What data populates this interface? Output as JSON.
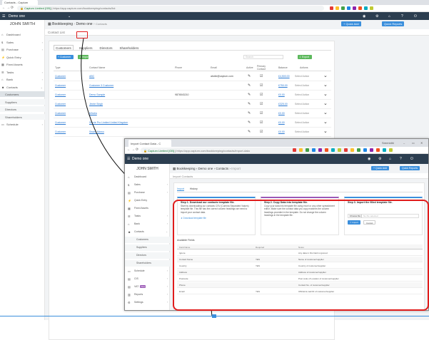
{
  "back": {
    "tab_title": "Contacts - Capium",
    "url_secure": "Capium Limited [GB]",
    "url_text": "https://app.capium.com/bookkeeping/contacts/list",
    "brand": "Demo one",
    "user": "JOHN SMITH",
    "sidebar": [
      {
        "label": "Dashboard",
        "icon": "⌂",
        "chev": ""
      },
      {
        "label": "Sales",
        "icon": "$",
        "chev": "›"
      },
      {
        "label": "Purchase",
        "icon": "▤",
        "chev": "›"
      },
      {
        "label": "Quick Entry",
        "icon": "⚡",
        "chev": ""
      },
      {
        "label": "Fixed Assets",
        "icon": "▦",
        "chev": ""
      },
      {
        "label": "Tasks",
        "icon": "☰",
        "chev": "›"
      },
      {
        "label": "Bank",
        "icon": "⌂",
        "chev": "›"
      },
      {
        "label": "Contacts",
        "icon": "☻",
        "chev": "⌄"
      },
      {
        "label": "Customers",
        "icon": "",
        "chev": "",
        "sub": true,
        "active": true
      },
      {
        "label": "Suppliers",
        "icon": "",
        "chev": "",
        "sub": true
      },
      {
        "label": "Directors",
        "icon": "",
        "chev": "",
        "sub": true
      },
      {
        "label": "Shareholders",
        "icon": "",
        "chev": "",
        "sub": true
      },
      {
        "label": "Schedule",
        "icon": "▭",
        "chev": "›"
      }
    ],
    "breadcrumb": [
      "Bookkeeping",
      "Demo one",
      "Contacts"
    ],
    "quick_add": "+ Quick Add",
    "quick_reports": "Quick Reports",
    "page_heading": "Contact List",
    "tabs": [
      "Customers",
      "Suppliers",
      "Directors",
      "Shareholders"
    ],
    "add_label": "+ Customer",
    "import_label": "⇩ Import",
    "export_label": "⇩ Export",
    "search_placeholder": "Search",
    "columns": [
      "Type",
      "Contact Name",
      "Phone",
      "Email",
      "Active",
      "Primary Contact",
      "Balance",
      "Actions"
    ],
    "rows": [
      {
        "type": "Customer",
        "name": "ABC",
        "phone": "",
        "email": "abcltd@capium.com",
        "balance": "£4,500.00",
        "action": "Select Action"
      },
      {
        "type": "Customer",
        "name": "Customer 3 Customer",
        "phone": "",
        "email": "",
        "balance": "£750.00",
        "action": "Select Action"
      },
      {
        "type": "Customer",
        "name": "Demo Sample",
        "phone": "9876543210",
        "email": "",
        "balance": "£0.00",
        "action": "Select Action"
      },
      {
        "type": "Customer",
        "name": "Jinnie Singh",
        "phone": "",
        "email": "",
        "balance": "£325.00",
        "action": "Select Action"
      },
      {
        "type": "Customer",
        "name": "Mindra",
        "phone": "",
        "email": "",
        "balance": "£0.00",
        "action": "Select Action"
      },
      {
        "type": "Customer",
        "name": "Stevie Pro Limited United Kingdom",
        "phone": "",
        "email": "",
        "balance": "£0.00",
        "action": "Select Action"
      },
      {
        "type": "Customer",
        "name": "Swara Maroo",
        "phone": "",
        "email": "",
        "balance": "£0.00",
        "action": "Select Action"
      }
    ]
  },
  "front": {
    "tab_title": "Import Contact Data - C",
    "win_user": "Sreenidhi",
    "url_secure": "Capium Limited [GB]",
    "url_text": "https://app.capium.com/bookkeeping/contacts/import-data",
    "brand": "Demo one",
    "user": "JOHN SMITH",
    "sidebar": [
      {
        "label": "Dashboard",
        "icon": "⌂",
        "chev": ""
      },
      {
        "label": "Sales",
        "icon": "$",
        "chev": "›"
      },
      {
        "label": "Purchase",
        "icon": "▤",
        "chev": "›"
      },
      {
        "label": "Quick Entry",
        "icon": "⚡",
        "chev": ""
      },
      {
        "label": "Fixed Assets",
        "icon": "▦",
        "chev": ""
      },
      {
        "label": "Tasks",
        "icon": "☰",
        "chev": "›"
      },
      {
        "label": "Bank",
        "icon": "⌂",
        "chev": "›"
      },
      {
        "label": "Contacts",
        "icon": "☻",
        "chev": "⌄"
      },
      {
        "label": "Customers",
        "icon": "",
        "chev": "",
        "sub": true
      },
      {
        "label": "Suppliers",
        "icon": "",
        "chev": "",
        "sub": true
      },
      {
        "label": "Directors",
        "icon": "",
        "chev": "",
        "sub": true
      },
      {
        "label": "Shareholders",
        "icon": "",
        "chev": "",
        "sub": true
      },
      {
        "label": "Schedule",
        "icon": "▭",
        "chev": "›"
      },
      {
        "label": "CIS",
        "icon": "▤",
        "chev": "›"
      },
      {
        "label": "VAT",
        "icon": "▤",
        "chev": "›",
        "badge": "New"
      },
      {
        "label": "Reports",
        "icon": "▥",
        "chev": "›"
      },
      {
        "label": "Settings",
        "icon": "⚙",
        "chev": "›"
      }
    ],
    "breadcrumb": [
      "Bookkeeping",
      "Demo one",
      "Contacts",
      "Import"
    ],
    "quick_add": "+ Quick Add",
    "quick_reports": "Quick Reports",
    "page_heading": "Import Contacts",
    "tabs": [
      "Import",
      "History"
    ],
    "steps": [
      {
        "title": "Step 1. Download our contacts template file.",
        "text": "Start by downloading our contacts CSV (Comma Separated Values) template file. This file has the correct column headings we need to import your contact data.",
        "link": "⬇ Download template file"
      },
      {
        "title": "Step 2. Copy Data into template file.",
        "text": "Copy your data into template file using excel or any other spreadsheet editor. Make sure the contact data you copy matches the column headings provided in the template. Do not change the column headings in the template file."
      },
      {
        "title": "Step 3. Import the filled template file.",
        "choose": "Choose file",
        "no_file": "No file selected",
        "import_btn": "⇩ Import",
        "cancel_btn": "Cancel"
      }
    ],
    "fields_heading": "Available Fields",
    "field_columns": [
      "Field Name",
      "Required",
      "Notes"
    ],
    "fields": [
      {
        "name": "Ignore",
        "req": "",
        "notes": "Any data in this field is ignored"
      },
      {
        "name": "Contact Name",
        "req": "YES",
        "notes": "Name of customer/supplier"
      },
      {
        "name": "Country",
        "req": "YES",
        "notes": "Country of customer/supplier"
      },
      {
        "name": "Address",
        "req": "",
        "notes": "Address of customer/supplier"
      },
      {
        "name": "Postcode",
        "req": "",
        "notes": "Post code of Location of customer/supplier"
      },
      {
        "name": "Phone",
        "req": "",
        "notes": "Contact No. of customer/supplier"
      },
      {
        "name": "Email",
        "req": "YES",
        "notes": "Official E-mail ID of customer/supplier"
      }
    ]
  },
  "colors": {
    "nav": "#2c3e50",
    "accent": "#3b8fdc",
    "green": "#5cb85c",
    "highlight": "#e01c1c"
  }
}
